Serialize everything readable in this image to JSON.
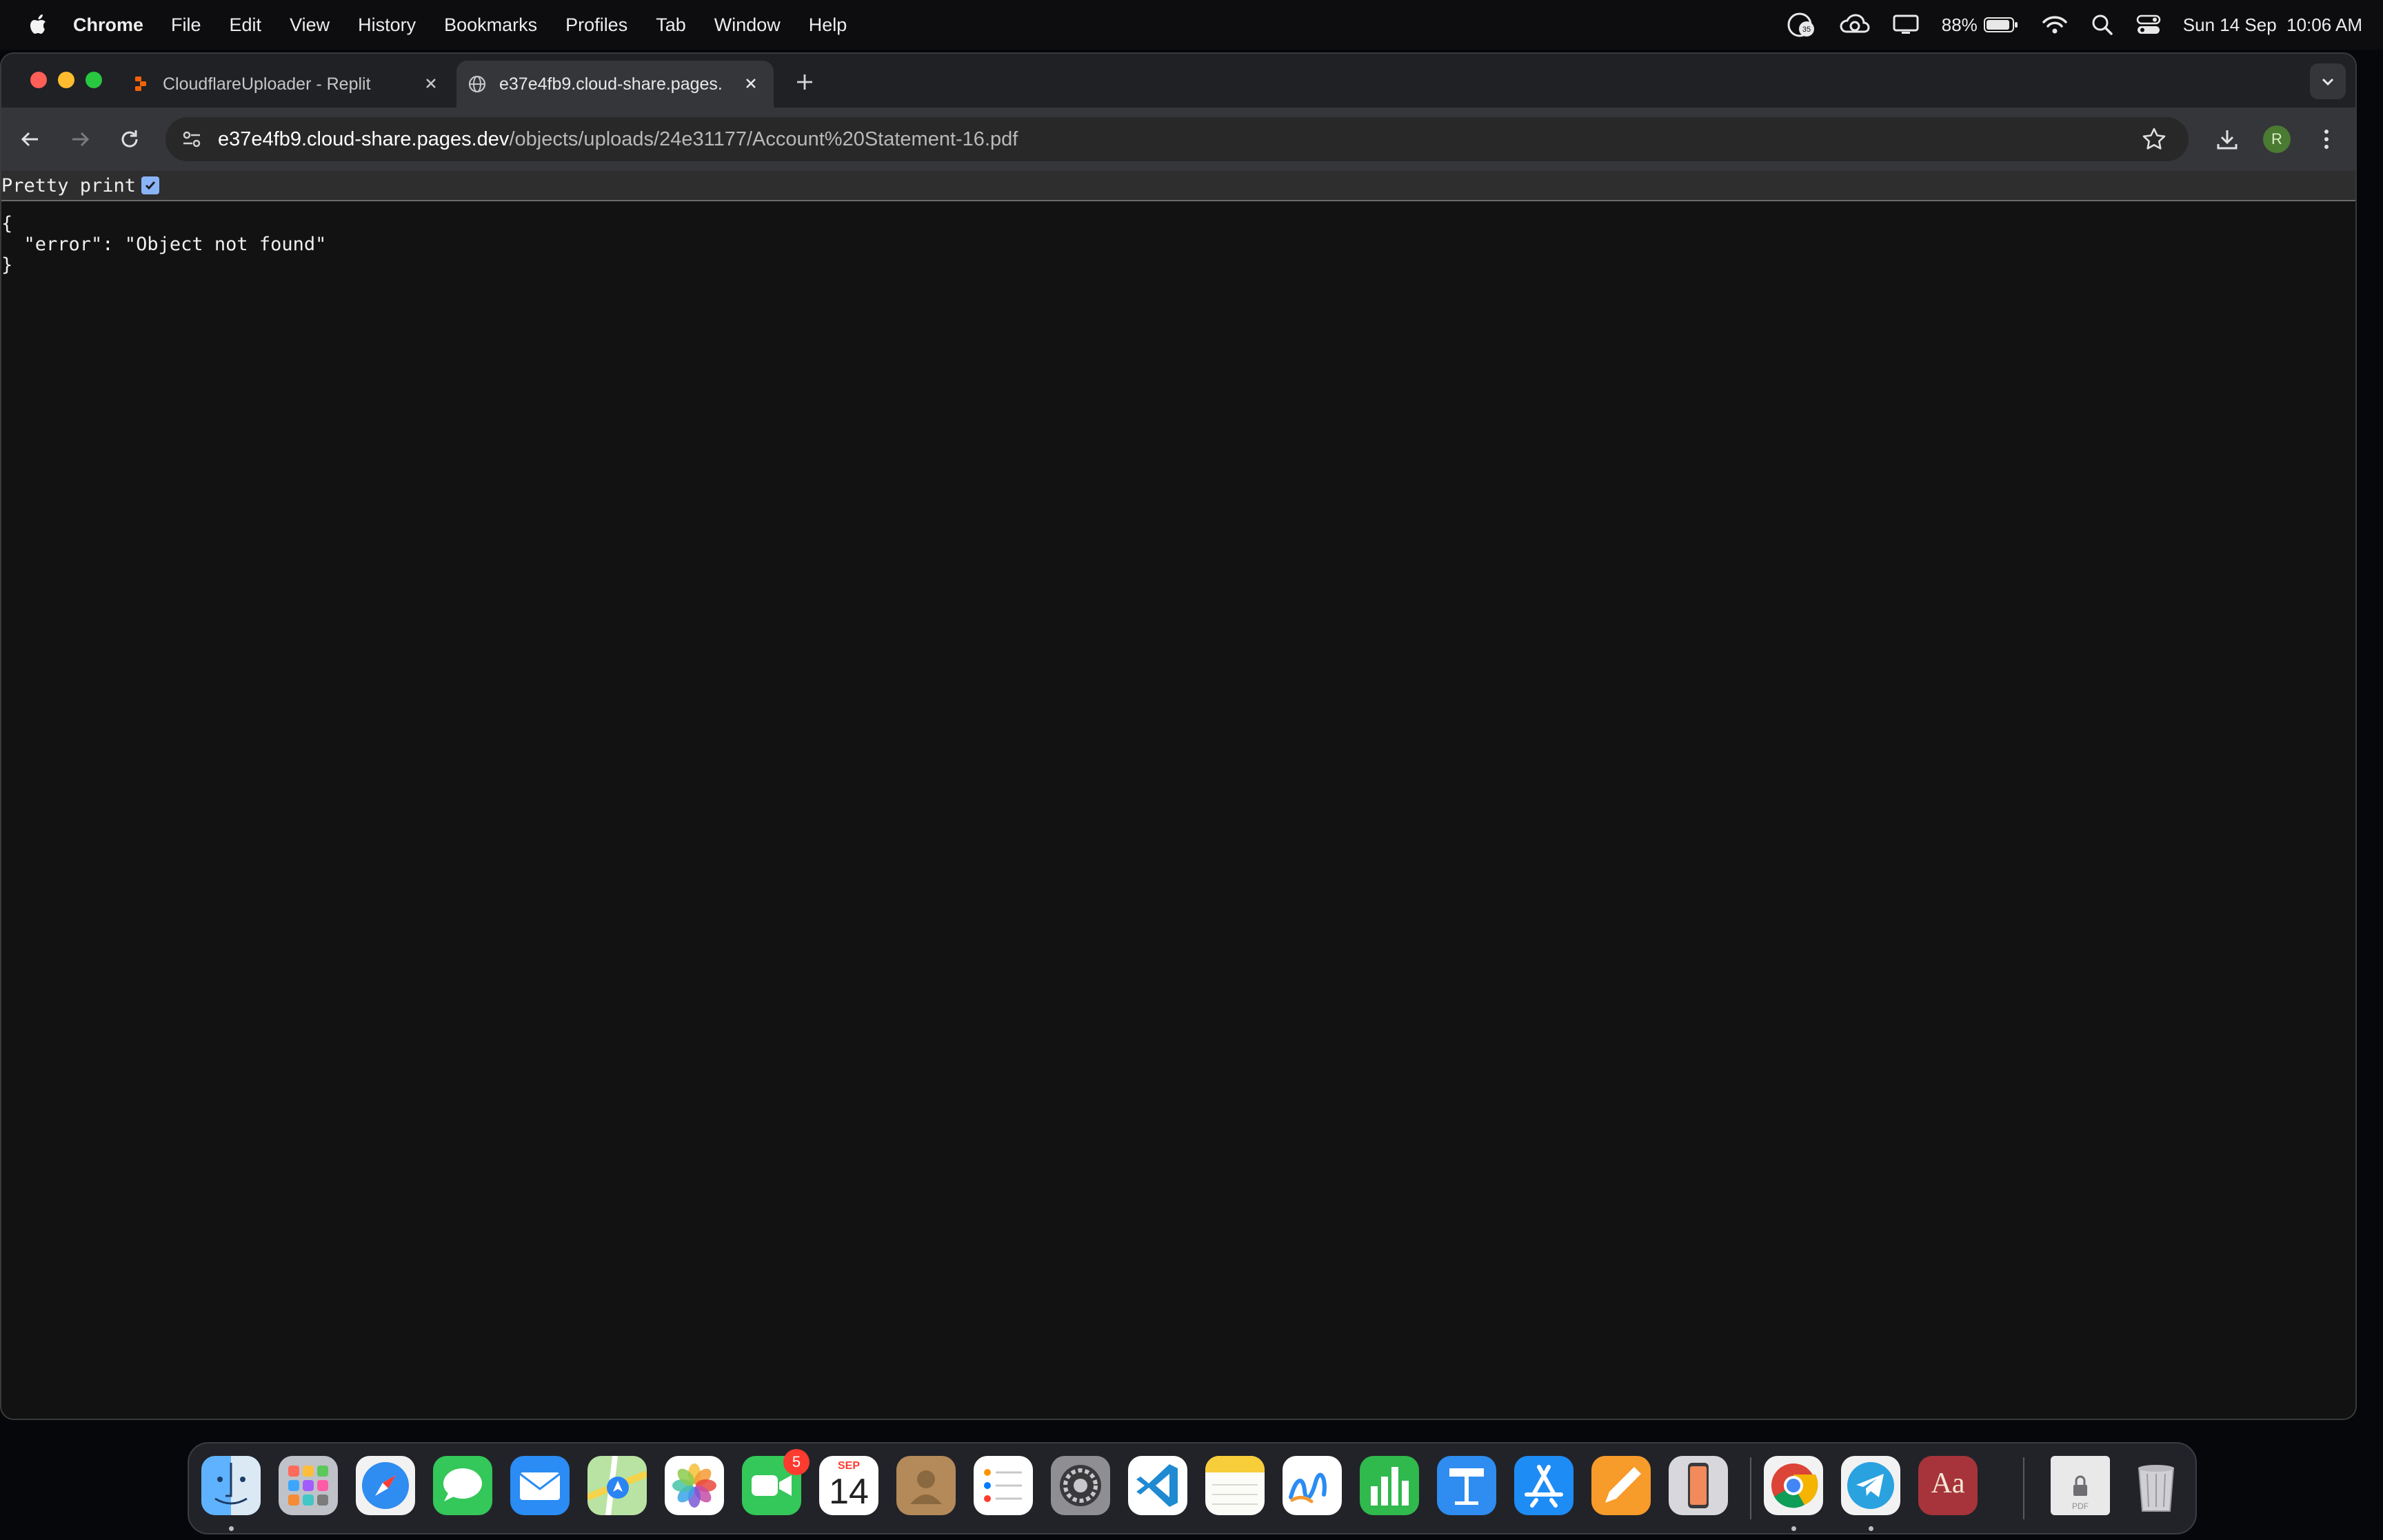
{
  "menubar": {
    "app": "Chrome",
    "items": [
      "File",
      "Edit",
      "View",
      "History",
      "Bookmarks",
      "Profiles",
      "Tab",
      "Window",
      "Help"
    ],
    "status": {
      "notification_count": "35",
      "battery": "88%",
      "datetime": "Sun 14 Sep  10:06 AM"
    }
  },
  "browser": {
    "tabs": [
      {
        "title": "CloudflareUploader - Replit",
        "active": false
      },
      {
        "title": "e37e4fb9.cloud-share.pages.",
        "active": true
      }
    ],
    "url": {
      "host": "e37e4fb9.cloud-share.pages.dev",
      "path": "/objects/uploads/24e31177/Account%20Statement-16.pdf"
    },
    "profile_initial": "R"
  },
  "page": {
    "pretty_print_label": "Pretty print",
    "pretty_print_checked": true,
    "json_lines": [
      "{",
      "  \"error\": \"Object not found\"",
      "}"
    ]
  },
  "dock": {
    "calendar_month": "SEP",
    "calendar_day": "14",
    "facetime_badge": "5",
    "dictionary_label": "Aa",
    "pdf_label": "PDF"
  }
}
